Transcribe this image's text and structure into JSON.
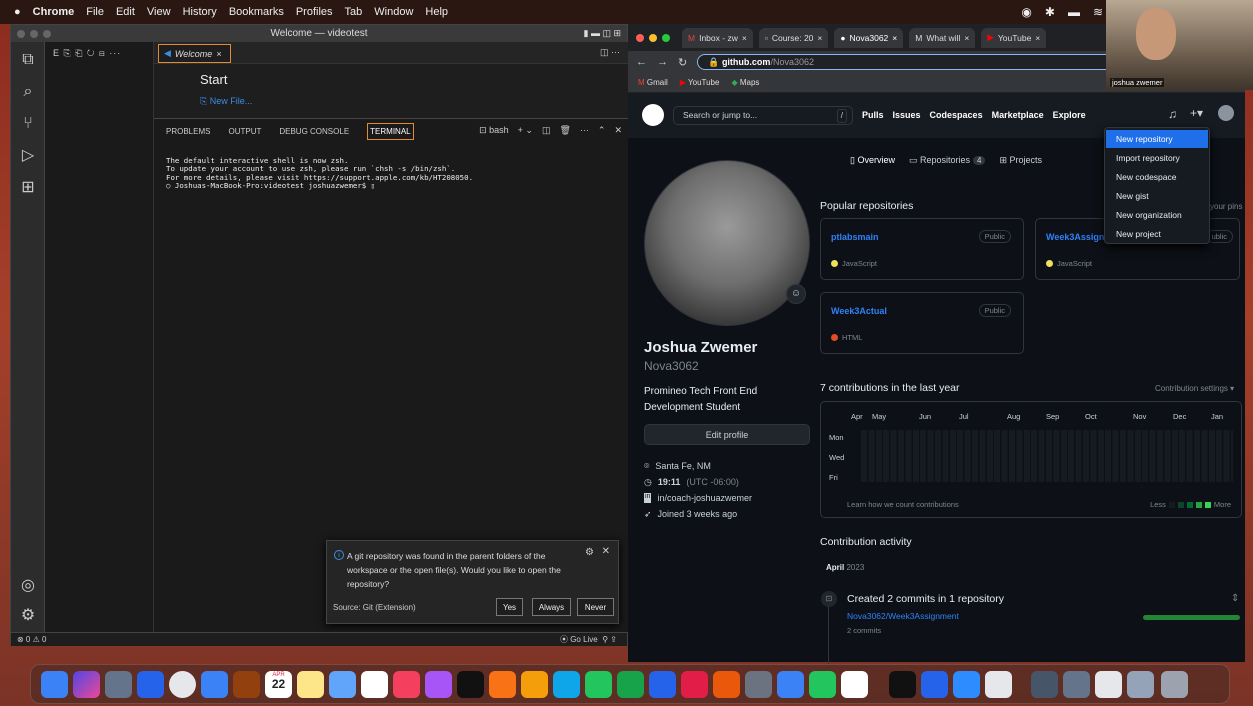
{
  "menubar": {
    "items": [
      "Chrome",
      "File",
      "Edit",
      "View",
      "History",
      "Bookmarks",
      "Profiles",
      "Tab",
      "Window",
      "Help"
    ]
  },
  "vscode": {
    "title": "Welcome — videotest",
    "tab": "Welcome",
    "start_heading": "Start",
    "new_file": "New File...",
    "panel_tabs": [
      "PROBLEMS",
      "OUTPUT",
      "DEBUG CONSOLE",
      "TERMINAL"
    ],
    "shell": "bash",
    "terminal_lines": [
      "The default interactive shell is now zsh.",
      "To update your account to use zsh, please run `chsh -s /bin/zsh`.",
      "For more details, please visit https://support.apple.com/kb/HT208050.",
      "Joshuas-MacBook-Pro:videotest joshuazwemer$ "
    ],
    "notification": {
      "text": "A git repository was found in the parent folders of the workspace or the open file(s). Would you like to open the repository?",
      "source": "Source: Git (Extension)",
      "btn_yes": "Yes",
      "btn_always": "Always",
      "btn_never": "Never"
    },
    "status_left": "⊗ 0 ⚠ 0",
    "status_right": "Go Live"
  },
  "chrome": {
    "tabs": [
      "Inbox - zw",
      "Course: 20",
      "Nova3062",
      "What will",
      "YouTube"
    ],
    "url_domain": "github.com",
    "url_path": "/Nova3062",
    "bookmarks": [
      "Gmail",
      "YouTube",
      "Maps"
    ]
  },
  "github": {
    "search_placeholder": "Search or jump to...",
    "search_key": "/",
    "nav": [
      "Pulls",
      "Issues",
      "Codespaces",
      "Marketplace",
      "Explore"
    ],
    "dropdown": [
      "New repository",
      "Import repository",
      "New codespace",
      "New gist",
      "New organization",
      "New project"
    ],
    "profile_tabs": {
      "overview": "Overview",
      "repositories": "Repositories",
      "repo_count": "4",
      "projects": "Projects"
    },
    "name": "Joshua Zwemer",
    "login": "Nova3062",
    "bio": "Promineo Tech Front End Development Student",
    "edit_profile": "Edit profile",
    "location": "Santa Fe, NM",
    "time": "19:11",
    "tz": "(UTC -06:00)",
    "linkedin": "in/coach-joshuazwemer",
    "joined": "Joined 3 weeks ago",
    "popular_title": "Popular repositories",
    "customize": "your pins",
    "repos": [
      {
        "name": "ptlabsmain",
        "badge": "Public",
        "lang": "JavaScript"
      },
      {
        "name": "Week3Assign",
        "badge": "ublic",
        "lang": "JavaScript"
      },
      {
        "name": "Week3Actual",
        "badge": "Public",
        "lang": "HTML"
      }
    ],
    "contrib_title": "7 contributions in the last year",
    "contrib_settings": "Contribution settings ▾",
    "months": [
      "Apr",
      "May",
      "Jun",
      "Jul",
      "Aug",
      "Sep",
      "Oct",
      "Nov",
      "Dec",
      "Jan"
    ],
    "days": [
      "Mon",
      "Wed",
      "Fri"
    ],
    "learn": "Learn how we count contributions",
    "less": "Less",
    "more": "More",
    "activity_title": "Contribution activity",
    "activity_month": "April",
    "activity_year": "2023",
    "commit_text": "Created 2 commits in 1 repository",
    "commit_repo": "Nova3062/Week3Assignment",
    "commit_count": "2 commits"
  },
  "webcam_label": "joshua zwemer",
  "dock_badges": {
    "calendar_month": "APR",
    "calendar_day": "22"
  }
}
